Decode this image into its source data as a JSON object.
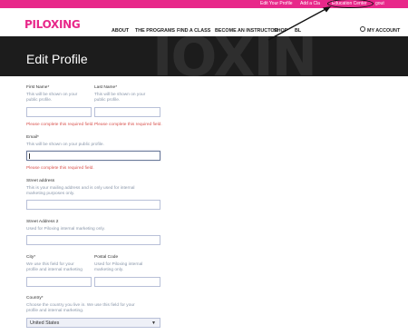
{
  "topbar": {
    "edit_profile": "Edit Your Profile",
    "add_class": "Add a Cla",
    "education_center": "Education Center",
    "logout": "gout"
  },
  "header": {
    "logo": "PILOXING",
    "nav": [
      "ABOUT",
      "THE PROGRAMS",
      "FIND A CLASS",
      "BECOME AN INSTRUCTOR",
      "SHOP",
      "BL"
    ],
    "my_account": "MY ACCOUNT"
  },
  "hero": {
    "title": "Edit Profile",
    "deco": "IOXIN"
  },
  "form": {
    "first_name": {
      "label": "First Name*",
      "help": [
        "This will be shown on your",
        "public profile."
      ],
      "error": "Please complete this required field."
    },
    "last_name": {
      "label": "Last Name*",
      "help": [
        "This will be shown on your",
        "public profile."
      ],
      "error": "Please complete this required field."
    },
    "email": {
      "label": "Email*",
      "help": "This will be shown on your public profile.",
      "error": "Please complete this required field."
    },
    "street": {
      "label": "Street address",
      "help": [
        "This is your mailing address and is only used for internal",
        "marketing purposes only."
      ]
    },
    "street2": {
      "label": "Street Address 2",
      "help": "Used for Piloxing internal marketing only."
    },
    "city": {
      "label": "City*",
      "help": [
        "We use this field for your",
        "profile and internal marketing"
      ]
    },
    "postal": {
      "label": "Postal Code",
      "help": [
        "Used for Piloxing internal",
        "marketing only."
      ]
    },
    "country": {
      "label": "Country*",
      "help": [
        "Choose the country you live in. We use this field for your",
        "profile and internal marketing."
      ],
      "selected": "United States"
    }
  }
}
